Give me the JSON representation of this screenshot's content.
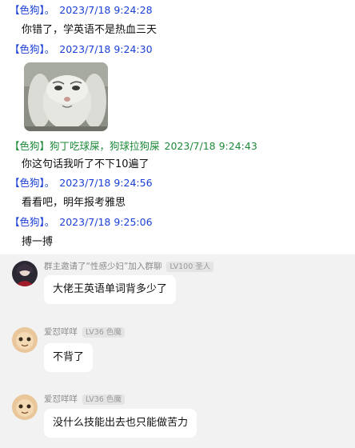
{
  "log": [
    {
      "tag": "【色狗】。",
      "time": "2023/7/18 9:24:28",
      "text": "你错了，学英语不是热血三天"
    },
    {
      "tag": "【色狗】。",
      "time": "2023/7/18 9:24:30"
    },
    {
      "tag": "【色狗】狗丁吃球屎，狗球拉狗屎",
      "time": "2023/7/18 9:24:43",
      "text": "你这句话我听了不下10遍了"
    },
    {
      "tag": "【色狗】。",
      "time": "2023/7/18 9:24:56",
      "text": "看看吧，明年报考雅思"
    },
    {
      "tag": "【色狗】。",
      "time": "2023/7/18 9:25:06",
      "text": "搏一搏"
    }
  ],
  "chat": [
    {
      "name": "群主邀请了“性感少妇”加入群聊",
      "badge": "LV100 圣人",
      "text": "大佬王英语单词背多少了"
    },
    {
      "name": "爱怼咩咩",
      "badge": "LV36 色魔",
      "text": "不背了"
    },
    {
      "name": "爱怼咩咩",
      "badge": "LV36 色魔",
      "text": "没什么技能出去也只能做苦力"
    }
  ],
  "colors": {
    "blue_header": "#1a3fd6",
    "green_header": "#1f8a3a",
    "chat_bg": "#f2f2f2"
  }
}
